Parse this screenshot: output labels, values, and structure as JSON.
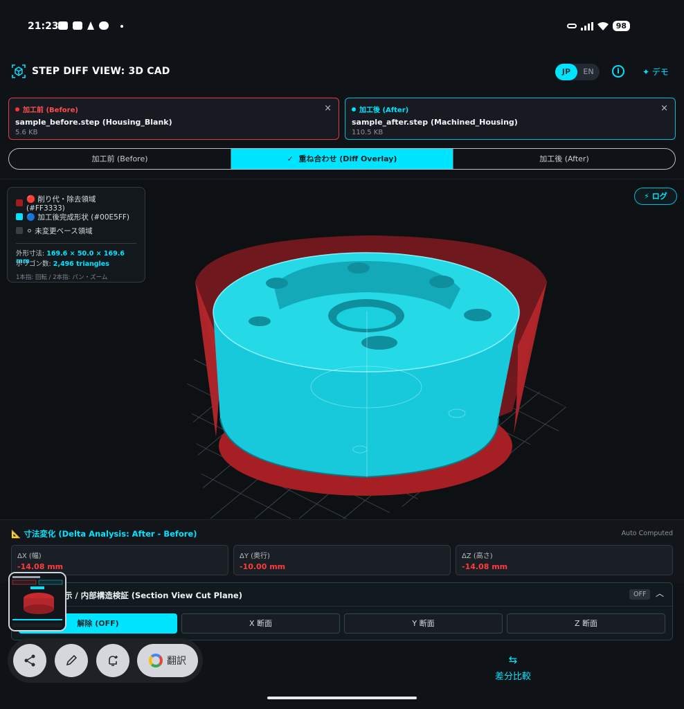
{
  "status_bar": {
    "time": "21:23",
    "battery": "98"
  },
  "header": {
    "title": "STEP DIFF VIEW: 3D CAD",
    "lang": [
      "JP",
      "EN"
    ],
    "info_icon": "i",
    "demo_label": "デモ"
  },
  "files": {
    "before": {
      "tag": "加工前 (Before)",
      "name": "sample_before.step (Housing_Blank)",
      "size": "5.6 KB",
      "close": "×"
    },
    "after": {
      "tag": "加工後 (After)",
      "name": "sample_after.step (Machined_Housing)",
      "size": "110.5 KB",
      "close": "×"
    }
  },
  "view_tabs": [
    {
      "label": "加工前 (Before)"
    },
    {
      "label": "重ね合わせ (Diff Overlay)",
      "check": "✓"
    },
    {
      "label": "加工後 (After)"
    }
  ],
  "legend": {
    "items": [
      {
        "label": "🔴 削り代・除去領域 (#FF3333)",
        "color": "#a11d1d"
      },
      {
        "label": "🔵 加工後完成形状 (#00E5FF)",
        "color": "#00e5ff"
      },
      {
        "label": "⚪ 未変更ベース領域",
        "color": "#3a3f45"
      }
    ],
    "dims_label": "外形寸法:",
    "dims_value": "169.6 × 50.0 × 169.6 mm",
    "polys_label": "ポリゴン数:",
    "polys_value": "2,496 triangles",
    "hint": "1本指: 回転 / 2本指: パン・ズーム"
  },
  "log_button": "⚡ ログ",
  "delta": {
    "title": "寸法変化 (Delta Analysis: After - Before)",
    "title_icon": "📐",
    "auto": "Auto Computed",
    "cards": [
      {
        "label": "ΔX (幅)",
        "value": "-14.08 mm"
      },
      {
        "label": "ΔY (奥行)",
        "value": "-10.00 mm"
      },
      {
        "label": "ΔZ (高さ)",
        "value": "-14.08 mm"
      }
    ]
  },
  "section": {
    "title": "示 / 内部構造検証 (Section View Cut Plane)",
    "badge": "OFF",
    "chevron": "︿",
    "buttons": [
      "解除 (OFF)",
      "X 断面",
      "Y 断面",
      "Z 断面"
    ]
  },
  "bottom_nav": {
    "icon": "⇆",
    "label": "差分比較"
  },
  "toolbar": {
    "translate_label": "翻訳"
  },
  "colors": {
    "accent": "#00e5ff",
    "removed": "#ff3333",
    "before_border": "#e53945"
  }
}
